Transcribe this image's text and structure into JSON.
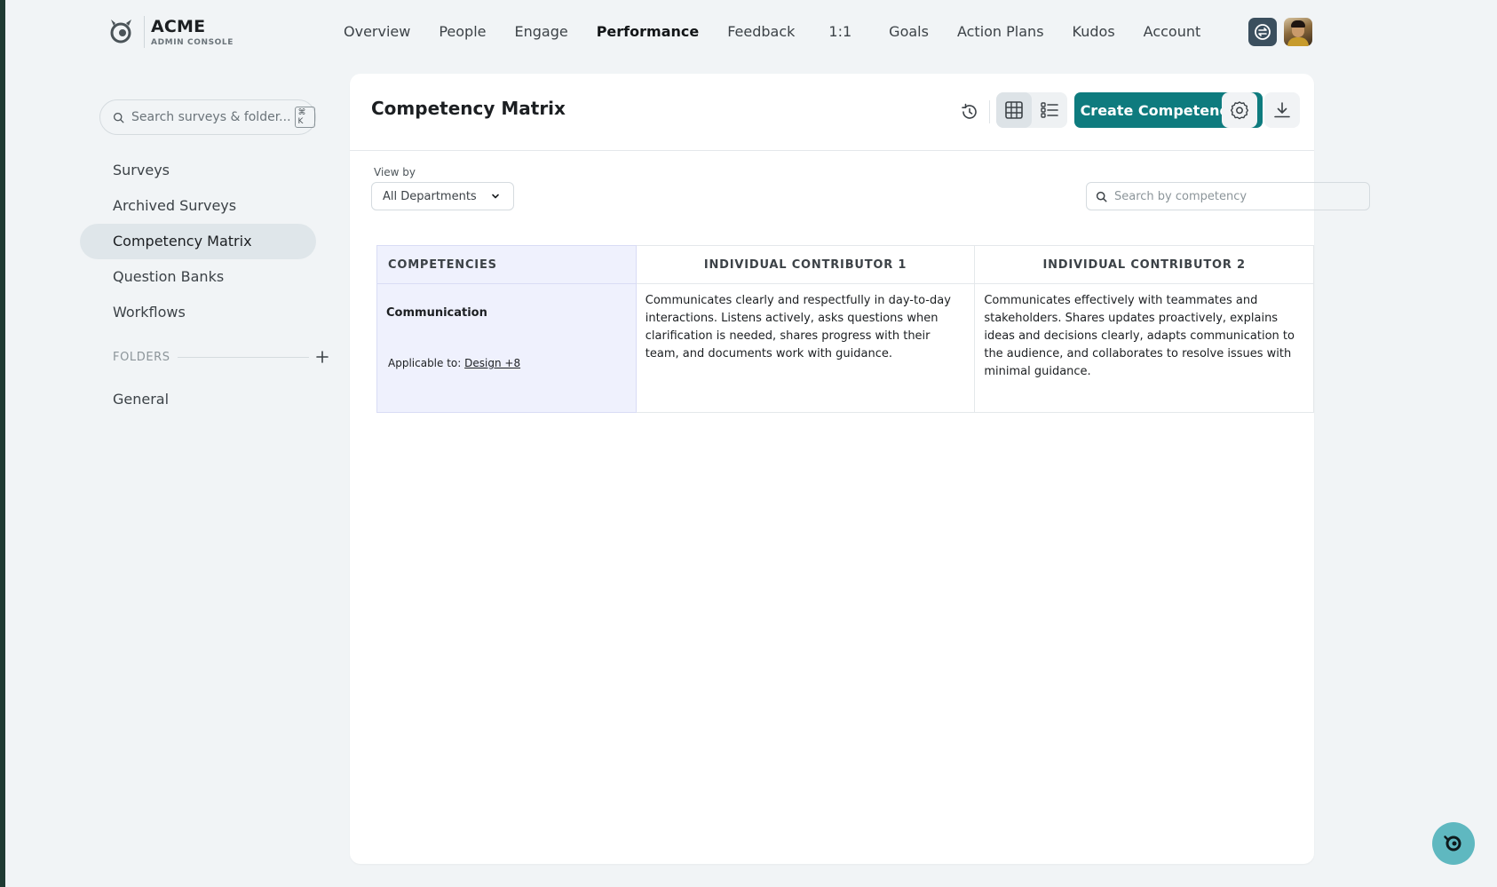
{
  "brand": {
    "name": "ACME",
    "subtitle": "ADMIN CONSOLE"
  },
  "nav": {
    "items": [
      "Overview",
      "People",
      "Engage",
      "Performance",
      "Feedback",
      "1:1",
      "Goals",
      "Action Plans",
      "Kudos",
      "Account"
    ],
    "active": "Performance"
  },
  "sidebar": {
    "search_placeholder": "Search surveys & folder...",
    "search_shortcut": "⌘ K",
    "items": [
      "Surveys",
      "Archived Surveys",
      "Competency Matrix",
      "Question Banks",
      "Workflows"
    ],
    "active": "Competency Matrix",
    "folders_label": "FOLDERS",
    "folders": [
      "General"
    ]
  },
  "page": {
    "title": "Competency Matrix",
    "create_button": "Create Competency",
    "view_by_label": "View by",
    "department_select": "All Departments",
    "search_placeholder": "Search by competency"
  },
  "matrix": {
    "headers": [
      "COMPETENCIES",
      "INDIVIDUAL CONTRIBUTOR 1",
      "INDIVIDUAL CONTRIBUTOR 2"
    ],
    "rows": [
      {
        "competency": "Communication",
        "applicable_label": "Applicable to:",
        "applicable_link": "Design +8",
        "levels": [
          "Communicates clearly and respectfully in day-to-day interactions. Listens actively, asks questions when clarification is needed, shares progress with their team, and documents work with guidance.",
          "Communicates effectively with teammates and stakeholders. Shares updates proactively, explains ideas and decisions clearly, adapts communication to the audience, and collaborates to resolve issues with minimal guidance."
        ]
      }
    ]
  },
  "colors": {
    "accent": "#0e7b7e",
    "competency_column_bg": "#eff1fd",
    "page_bg": "#f1f4f6",
    "fab": "#5fb8c0"
  },
  "icons": {
    "history": "history-icon",
    "grid": "grid-view-icon",
    "list": "list-view-icon",
    "settings": "settings-icon",
    "download": "download-icon",
    "chat": "chat-icon"
  }
}
